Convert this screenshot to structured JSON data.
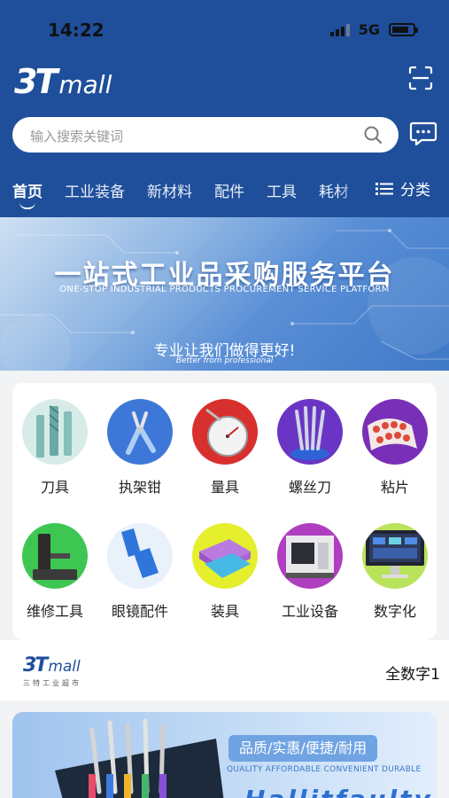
{
  "status_bar": {
    "time": "14:22",
    "network": "5G",
    "battery_level": 0.8
  },
  "header": {
    "logo_main": "3T",
    "logo_sub": "mall",
    "search_placeholder": "输入搜索关键词",
    "nav_tabs": [
      "首页",
      "工业装备",
      "新材料",
      "配件",
      "工具",
      "耗材"
    ],
    "active_tab": "首页",
    "category_label": "分类",
    "brand_color": "#1f4f9b"
  },
  "banner": {
    "title": "一站式工业品采购服务平台",
    "subtitle": "ONE-STOP INDUSTRIAL PRODUCTS PROCUREMENT SERVICE PLATFORM",
    "slogan": "专业让我们做得更好!",
    "slogan_en": "Better from professional"
  },
  "categories": [
    {
      "label": "刀具",
      "icon": "end-mill-icon"
    },
    {
      "label": "执架钳",
      "icon": "pliers-icon"
    },
    {
      "label": "量具",
      "icon": "dial-gauge-icon"
    },
    {
      "label": "螺丝刀",
      "icon": "screwdriver-set-icon"
    },
    {
      "label": "粘片",
      "icon": "sticker-roll-icon"
    },
    {
      "label": "维修工具",
      "icon": "repair-stand-icon"
    },
    {
      "label": "眼镜配件",
      "icon": "glasses-pads-icon"
    },
    {
      "label": "装具",
      "icon": "tray-icon"
    },
    {
      "label": "工业设备",
      "icon": "cnc-machine-icon"
    },
    {
      "label": "数字化",
      "icon": "monitor-icon"
    }
  ],
  "brand_strip": {
    "logo_main": "3T",
    "logo_sub": "mall",
    "logo_cn": "三特工业超市",
    "tab_label": "全数字1"
  },
  "promo": {
    "pill": "品质/实惠/便捷/耐用",
    "en": "QUALITY AFFORDABLE CONVENIENT DURABLE",
    "big": "Hallitfaulty"
  }
}
